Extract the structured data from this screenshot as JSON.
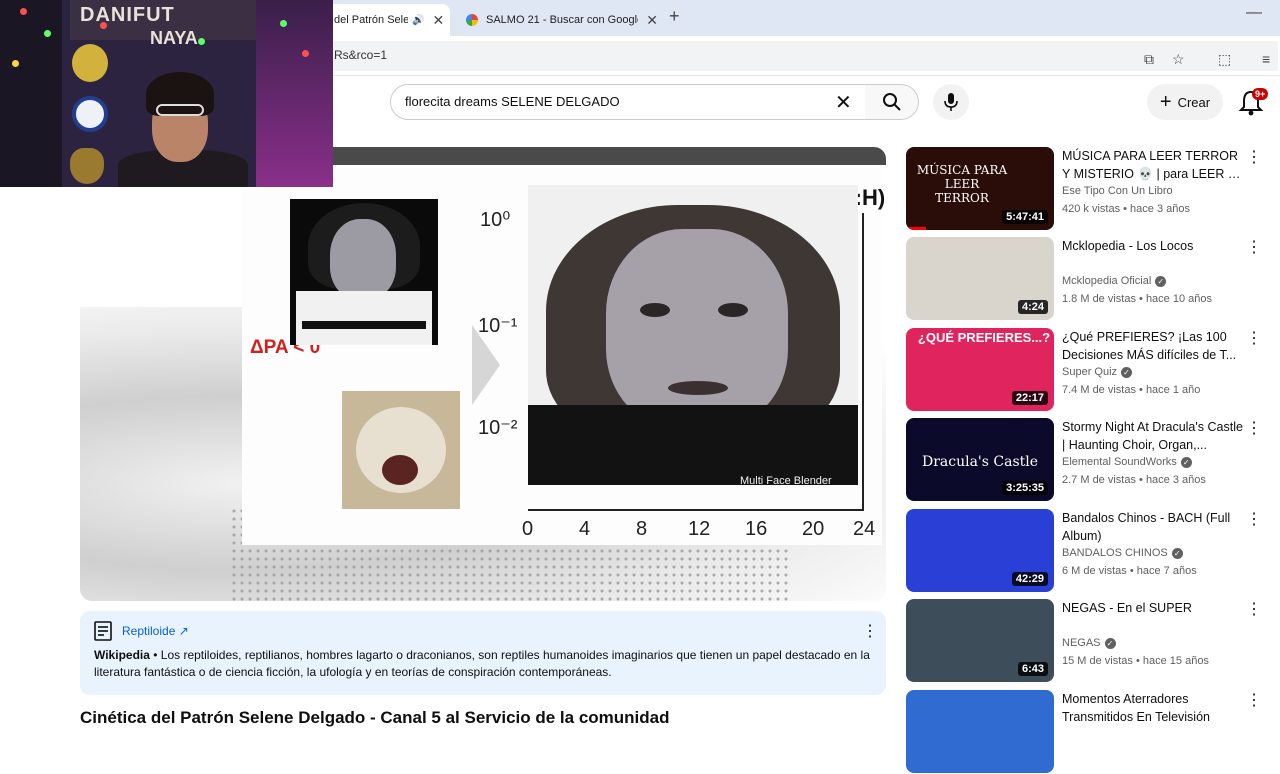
{
  "browser": {
    "tabs": [
      {
        "title": "del Patrón Sele",
        "active": true
      },
      {
        "title": "SALMO 21 - Buscar con Google",
        "active": false
      }
    ],
    "url_fragment": "Rs&rco=1"
  },
  "youtube": {
    "search_query": "florecita dreams SELENE DELGADO",
    "create_label": "Crear",
    "notification_badge": "9+"
  },
  "player": {
    "formula": "(C:G:H)⁺",
    "y_ticks": [
      "10⁰",
      "10⁻¹",
      "10⁻²"
    ],
    "x_ticks": [
      "0",
      "4",
      "8",
      "12",
      "16",
      "20",
      "24"
    ],
    "delta_label": "ΔPA < 0",
    "watermark": "Multi Face Blender"
  },
  "webcam": {
    "banner_line1": "DANIFUT",
    "banner_line2": "NAYA"
  },
  "info_card": {
    "link": "Reptiloide ↗",
    "source": "Wikipedia",
    "text": " • Los reptiloides, reptilianos, hombres lagarto o draconianos, son reptiles humanoides imaginarios que tienen un papel destacado en la literatura fantástica o de ciencia ficción, la ufología y en teorías de conspiración contemporáneas."
  },
  "video": {
    "title": "Cinética del Patrón Selene Delgado - Canal 5 al Servicio de la comunidad"
  },
  "recommendations": [
    {
      "title": "MÚSICA PARA LEER TERROR Y MISTERIO 💀 | para LEER en la...",
      "channel": "Ese Tipo Con Un Libro",
      "verified": false,
      "meta": "420 k vistas • hace 3 años",
      "duration": "5:47:41",
      "thumb_text": "MÚSICA PARA LEER TERROR",
      "thumb_color": "#2a0d08"
    },
    {
      "title": "Mcklopedia - Los Locos",
      "channel": "Mcklopedia Oficial",
      "verified": true,
      "meta": "1.8 M de vistas • hace 10 años",
      "duration": "4:24",
      "thumb_text": "",
      "thumb_color": "#d9d4cc"
    },
    {
      "title": "¿Qué PREFIERES? ¡Las 100 Decisiones MÁS difíciles de T...",
      "channel": "Super Quiz",
      "verified": true,
      "meta": "7.4 M de vistas • hace 1 año",
      "duration": "22:17",
      "thumb_text": "¿QUÉ PREFIERES...?",
      "thumb_color": "#e0255e"
    },
    {
      "title": "Stormy Night At Dracula's Castle | Haunting Choir, Organ,...",
      "channel": "Elemental SoundWorks",
      "verified": true,
      "meta": "2.7 M de vistas • hace 3 años",
      "duration": "3:25:35",
      "thumb_text": "Dracula's Castle",
      "thumb_color": "#0b0a2a"
    },
    {
      "title": "Bandalos Chinos - BACH (Full Album)",
      "channel": "BANDALOS CHINOS",
      "verified": true,
      "meta": "6 M de vistas • hace 7 años",
      "duration": "42:29",
      "thumb_text": "",
      "thumb_color": "#2a3fd6"
    },
    {
      "title": "NEGAS - En el SUPER",
      "channel": "NEGAS",
      "verified": true,
      "meta": "15 M de vistas • hace 15 años",
      "duration": "6:43",
      "thumb_text": "",
      "thumb_color": "#3e4d5a"
    },
    {
      "title": "Momentos Aterradores Transmitidos En Televisión",
      "channel": "",
      "verified": false,
      "meta": "",
      "duration": "",
      "thumb_text": "",
      "thumb_color": "#2f6bd1"
    }
  ],
  "colors": {
    "accent_red": "#ff0000",
    "link_blue": "#065fd4",
    "info_bg": "#e9f3fd"
  }
}
